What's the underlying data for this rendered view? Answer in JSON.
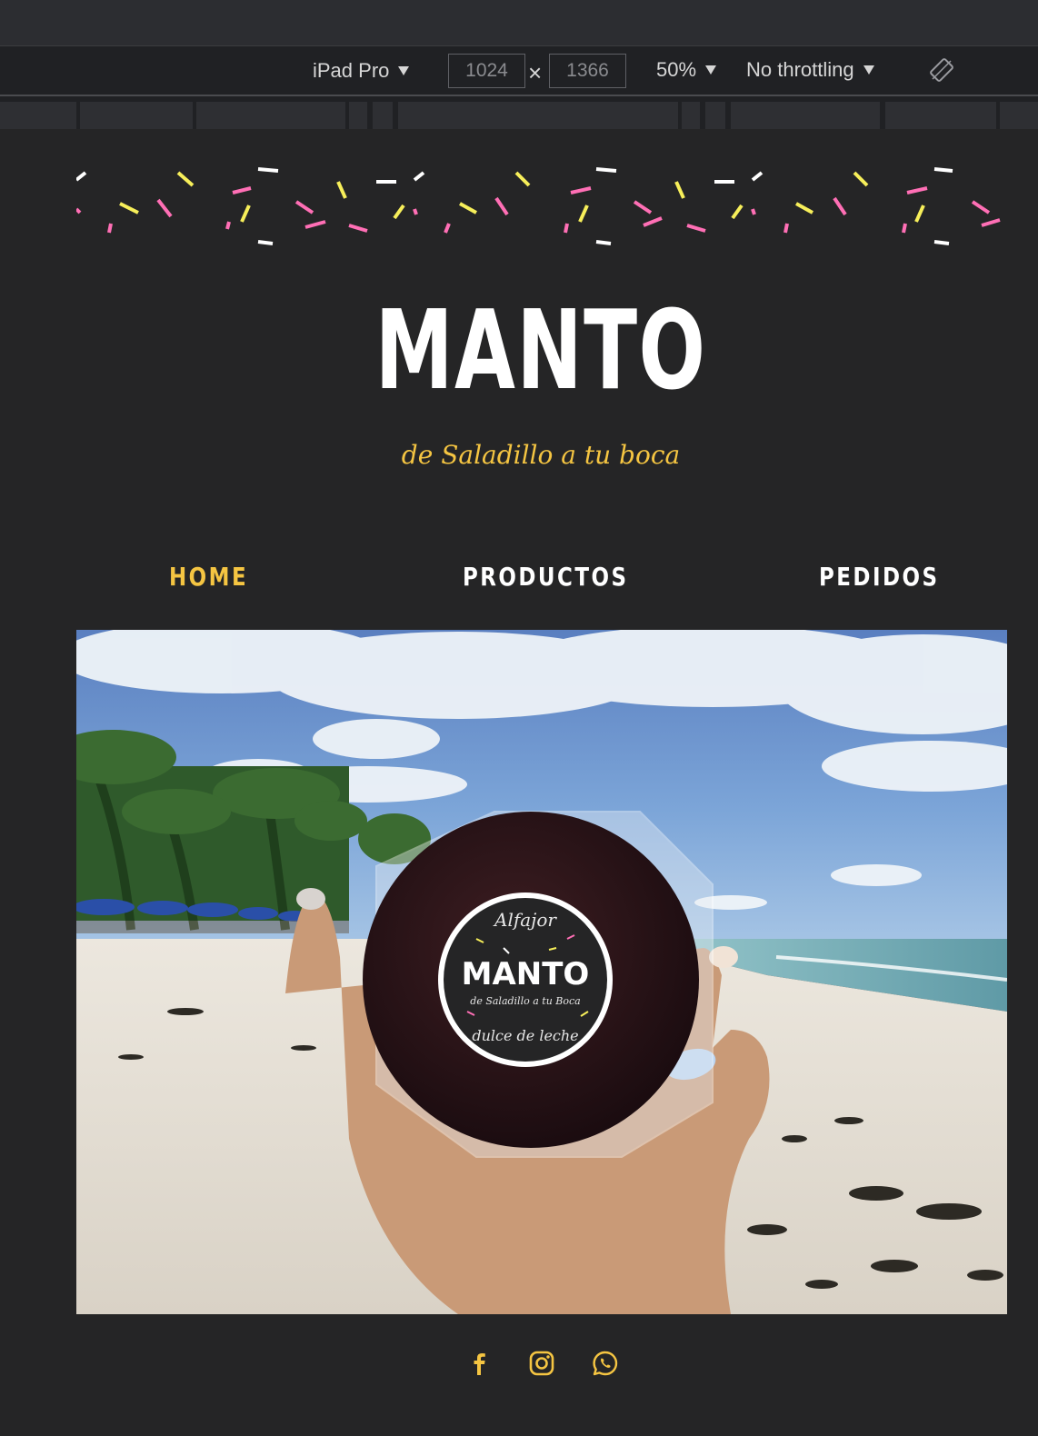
{
  "devtools": {
    "device": "iPad Pro",
    "width": "1024",
    "height": "1366",
    "times": "×",
    "zoom": "50%",
    "throttling": "No throttling",
    "icons": {
      "caret": "caret-down-icon",
      "rotate": "rotate-icon"
    }
  },
  "site": {
    "title": "MANTO",
    "tagline": "de Saladillo a tu boca",
    "nav": [
      {
        "label": "HOME",
        "active": true
      },
      {
        "label": "PRODUCTOS",
        "active": false
      },
      {
        "label": "PEDIDOS",
        "active": false
      }
    ],
    "hero": {
      "product_label": {
        "top": "Alfajor",
        "brand": "MANTO",
        "sub": "de Saladillo a tu Boca",
        "bottom": "dulce de leche"
      }
    },
    "socials": [
      "facebook-icon",
      "instagram-icon",
      "whatsapp-icon"
    ],
    "colors": {
      "accent": "#f5c542",
      "background": "#252526",
      "confetti_pink": "#ff6fb5",
      "confetti_yellow": "#f7ef5a",
      "confetti_white": "#ffffff"
    }
  }
}
